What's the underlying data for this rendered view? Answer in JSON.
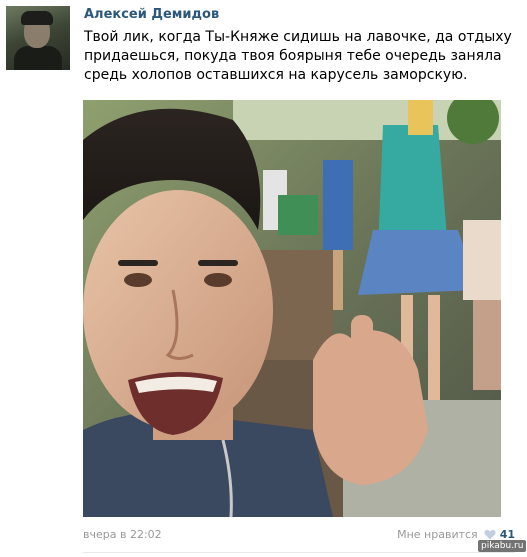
{
  "post": {
    "author_name": "Алексей Демидов",
    "text": "Твой лик, когда Ты-Княже сидишь на лавочке, да отдыху придаешься, покуда твоя боярыня тебе очередь заняла средь холопов оставшихся на карусель заморскую.",
    "date": "вчера в 22:02",
    "like_label": "Мне нравится",
    "like_count": "41"
  },
  "watermark": "pikabu.ru",
  "colors": {
    "link": "#2b587a",
    "muted": "#999999",
    "divider": "#e7e8ec"
  },
  "icons": {
    "like": "heart-icon",
    "avatar": "user-avatar"
  }
}
